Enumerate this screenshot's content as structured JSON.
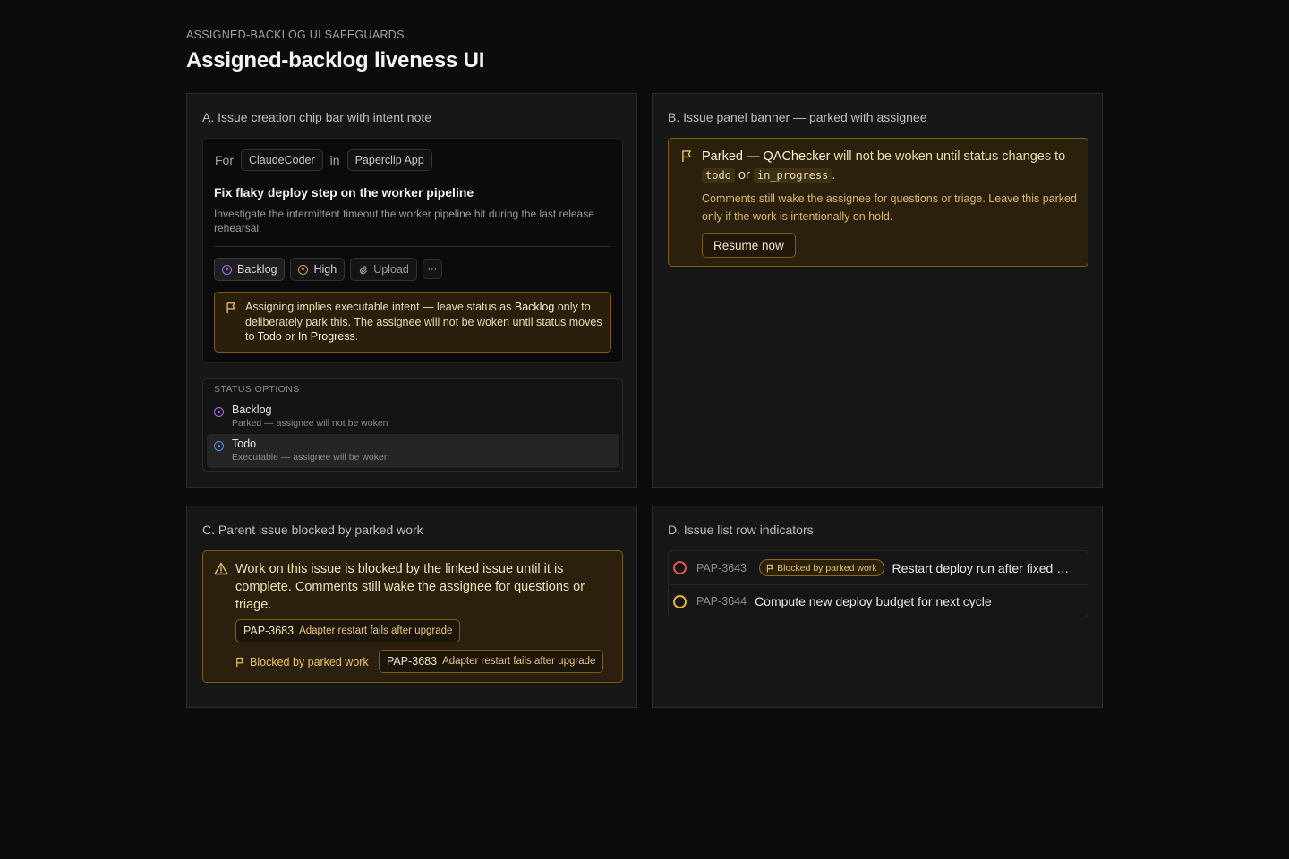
{
  "header": {
    "eyebrow": "ASSIGNED-BACKLOG UI SAFEGUARDS",
    "title": "Assigned-backlog liveness UI"
  },
  "panel_a": {
    "title": "A. Issue creation chip bar with intent note",
    "for_label": "For",
    "assignee": "ClaudeCoder",
    "in_label": "in",
    "project": "Paperclip App",
    "issue_title": "Fix flaky deploy step on the worker pipeline",
    "issue_description": "Investigate the intermittent timeout the worker pipeline hit during the last release rehearsal.",
    "chips": {
      "status": "Backlog",
      "priority": "High",
      "upload": "Upload",
      "more": "···"
    },
    "note": {
      "part1": "Assigning implies executable intent — leave status as ",
      "bold1": "Backlog",
      "part2": " only to deliberately park this. The assignee will not be woken until status moves to ",
      "bold2": "Todo",
      "part3": " or ",
      "bold3": "In Progress",
      "part4": "."
    },
    "status_options": {
      "heading": "STATUS OPTIONS",
      "items": [
        {
          "label": "Backlog",
          "sub": "Parked — assignee will not be woken"
        },
        {
          "label": "Todo",
          "sub": "Executable — assignee will be woken"
        }
      ]
    }
  },
  "panel_b": {
    "title": "B. Issue panel banner — parked with assignee",
    "banner": {
      "prefix": "Parked — ",
      "assignee": "QAChecker",
      "middle": " will not be woken until status changes to ",
      "code1": "todo",
      "or": " or ",
      "code2": "in_progress",
      "end": ".",
      "sub": "Comments still wake the assignee for questions or triage. Leave this parked only if the work is intentionally on hold.",
      "button": "Resume now"
    }
  },
  "panel_c": {
    "title": "C. Parent issue blocked by parked work",
    "message": "Work on this issue is blocked by the linked issue until it is complete. Comments still wake the assignee for questions or triage.",
    "link": {
      "id": "PAP-3683",
      "title": "Adapter restart fails after upgrade"
    },
    "blocked_label": "Blocked by parked work",
    "link2": {
      "id": "PAP-3683",
      "title": "Adapter restart fails after upgrade"
    }
  },
  "panel_d": {
    "title": "D. Issue list row indicators",
    "rows": [
      {
        "id": "PAP-3643",
        "badge": "Blocked by parked work",
        "title": "Restart deploy run after fixed build config",
        "status_color": "#e5534b"
      },
      {
        "id": "PAP-3644",
        "title": "Compute new deploy budget for next cycle",
        "status_color": "#e3b826"
      }
    ]
  },
  "colors": {
    "backlog": "#b06cf2",
    "high": "#e6972f",
    "todo": "#4a8fe6",
    "warning_border": "#7b5b18"
  }
}
